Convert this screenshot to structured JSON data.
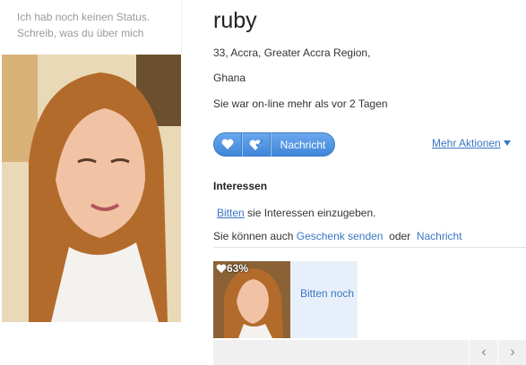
{
  "status": {
    "line1": "Ich hab noch keinen Status.",
    "line2": "Schreib, was du über mich"
  },
  "profile": {
    "name": "ruby",
    "location_line1": "33,  Accra, Greater Accra Region,",
    "location_line2": "Ghana",
    "last_online": "Sie war on-line mehr als vor 2 Tagen"
  },
  "actions": {
    "message_label": "Nachricht",
    "more_label": "Mehr Aktionen"
  },
  "interests": {
    "heading": "Interessen",
    "ask_link": "Bitten",
    "ask_text": " sie Interessen einzugeben.",
    "also_text": "Sie können auch ",
    "gift_link": "Geschenk senden",
    "or_text": "  oder  ",
    "message_link": "Nachricht"
  },
  "gift": {
    "percent": "63%",
    "ask_more": "Bitten noch"
  },
  "nav": {
    "prev": "‹",
    "next": "›"
  }
}
